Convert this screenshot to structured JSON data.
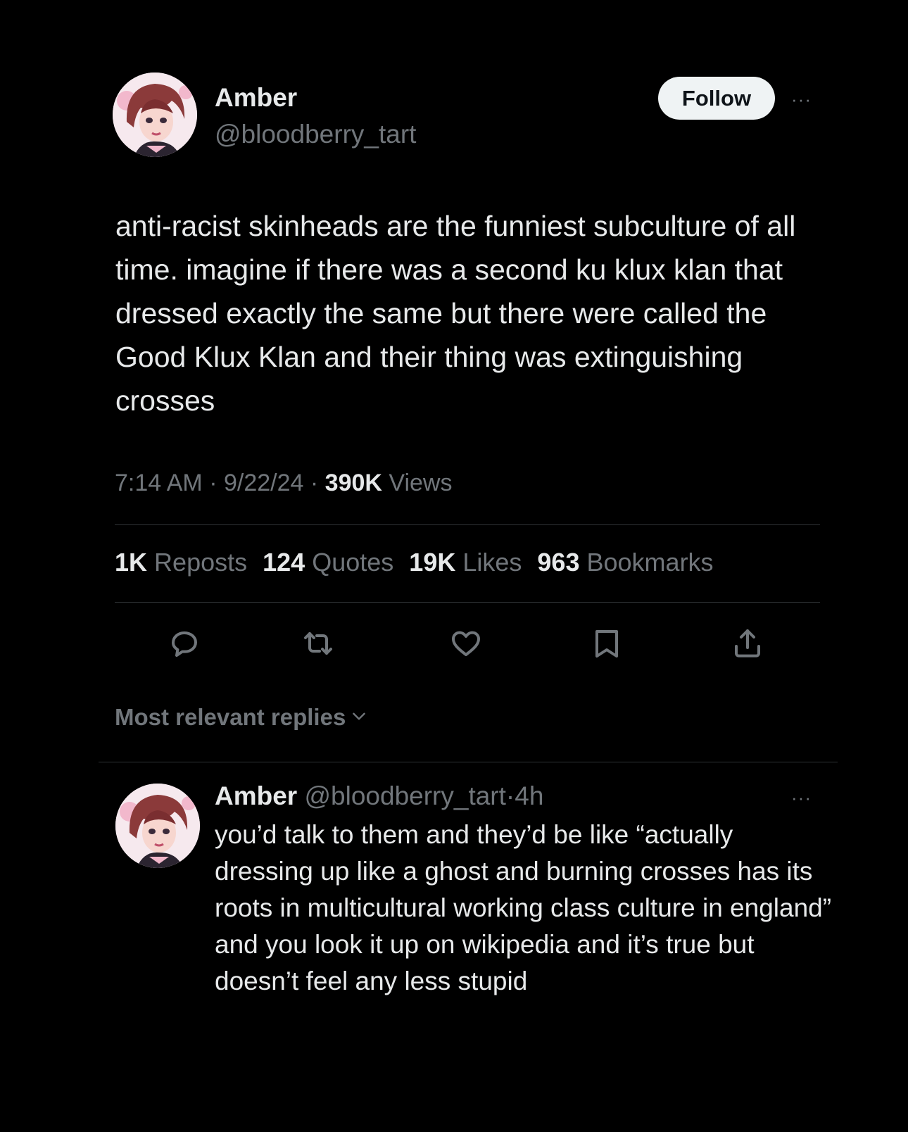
{
  "tweet": {
    "author_name": "Amber",
    "author_handle": "@bloodberry_tart",
    "follow_label": "Follow",
    "more_label": "···",
    "text": "anti-racist skinheads are the funniest subculture of all time. imagine if there was a second ku klux klan that dressed exactly the same but there were called the Good Klux Klan and their thing was extinguishing crosses",
    "time": "7:14 AM",
    "date": "9/22/24",
    "separator": "·",
    "views_count": "390K",
    "views_label": "Views"
  },
  "stats": [
    {
      "count": "1K",
      "label": "Reposts"
    },
    {
      "count": "124",
      "label": "Quotes"
    },
    {
      "count": "19K",
      "label": "Likes"
    },
    {
      "count": "963",
      "label": "Bookmarks"
    }
  ],
  "actions": {
    "reply_icon": "reply-icon",
    "repost_icon": "repost-icon",
    "like_icon": "heart-icon",
    "bookmark_icon": "bookmark-icon",
    "share_icon": "share-icon"
  },
  "replies_sort": {
    "label": "Most relevant replies"
  },
  "reply": {
    "author_name": "Amber",
    "author_handle": "@bloodberry_tart",
    "time": "4h",
    "separator": "·",
    "more_label": "···",
    "text": "you’d talk to them and they’d be like “actually dressing up like a ghost and burning crosses has its roots in multicultural working class culture in england” and you look it up on wikipedia and it’s true but doesn’t feel any less stupid"
  },
  "colors": {
    "background": "#000000",
    "primary_text": "#e7e9ea",
    "secondary_text": "#71767b",
    "divider": "#2f3336",
    "follow_bg": "#eff3f4"
  }
}
